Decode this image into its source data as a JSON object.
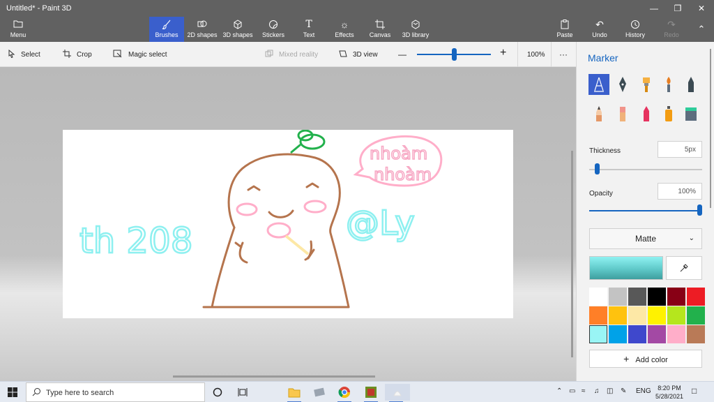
{
  "window": {
    "title": "Untitled* - Paint 3D"
  },
  "ribbon": {
    "menu_label": "Menu",
    "items": [
      {
        "label": "Brushes",
        "icon": "brush-icon"
      },
      {
        "label": "2D shapes",
        "icon": "2d-shapes-icon"
      },
      {
        "label": "3D shapes",
        "icon": "3d-shapes-icon"
      },
      {
        "label": "Stickers",
        "icon": "stickers-icon"
      },
      {
        "label": "Text",
        "icon": "text-icon"
      },
      {
        "label": "Effects",
        "icon": "effects-icon"
      },
      {
        "label": "Canvas",
        "icon": "canvas-icon"
      },
      {
        "label": "3D library",
        "icon": "3d-library-icon"
      }
    ],
    "active_item": "Brushes",
    "paste_label": "Paste",
    "undo_label": "Undo",
    "history_label": "History",
    "redo_label": "Redo"
  },
  "toolbar": {
    "select_label": "Select",
    "crop_label": "Crop",
    "magic_select_label": "Magic select",
    "mixed_reality_label": "Mixed reality",
    "view3d_label": "3D view",
    "zoom_minus": "—",
    "zoom_plus": "+",
    "zoom_value": "100%",
    "zoom_slider_fraction": 0.5,
    "more_label": "···"
  },
  "canvas": {
    "texts": {
      "left": "th 208",
      "right": "@Ly",
      "bubble_line1": "nhoàm",
      "bubble_line2": "nhoàm"
    }
  },
  "panel": {
    "title": "Marker",
    "thickness_label": "Thickness",
    "thickness_value": "5px",
    "thickness_fraction": 0.05,
    "opacity_label": "Opacity",
    "opacity_value": "100%",
    "opacity_fraction": 1.0,
    "finish_value": "Matte",
    "add_color_label": "Add color",
    "accent_color": "#1565c0",
    "selected_color": "#8ff2f2",
    "palette": [
      "#ffffff",
      "#c3c3c3",
      "#585858",
      "#000000",
      "#880015",
      "#ed1c24",
      "#ff7f27",
      "#ffc20e",
      "#fde8a6",
      "#fff200",
      "#b5e61d",
      "#22b14c",
      "#99f5f5",
      "#00a2e8",
      "#3f48cc",
      "#a349a4",
      "#ffaec9",
      "#b97a57"
    ]
  },
  "taskbar": {
    "search_placeholder": "Type here to search",
    "language": "ENG",
    "time": "8:20 PM",
    "date": "5/28/2021"
  }
}
